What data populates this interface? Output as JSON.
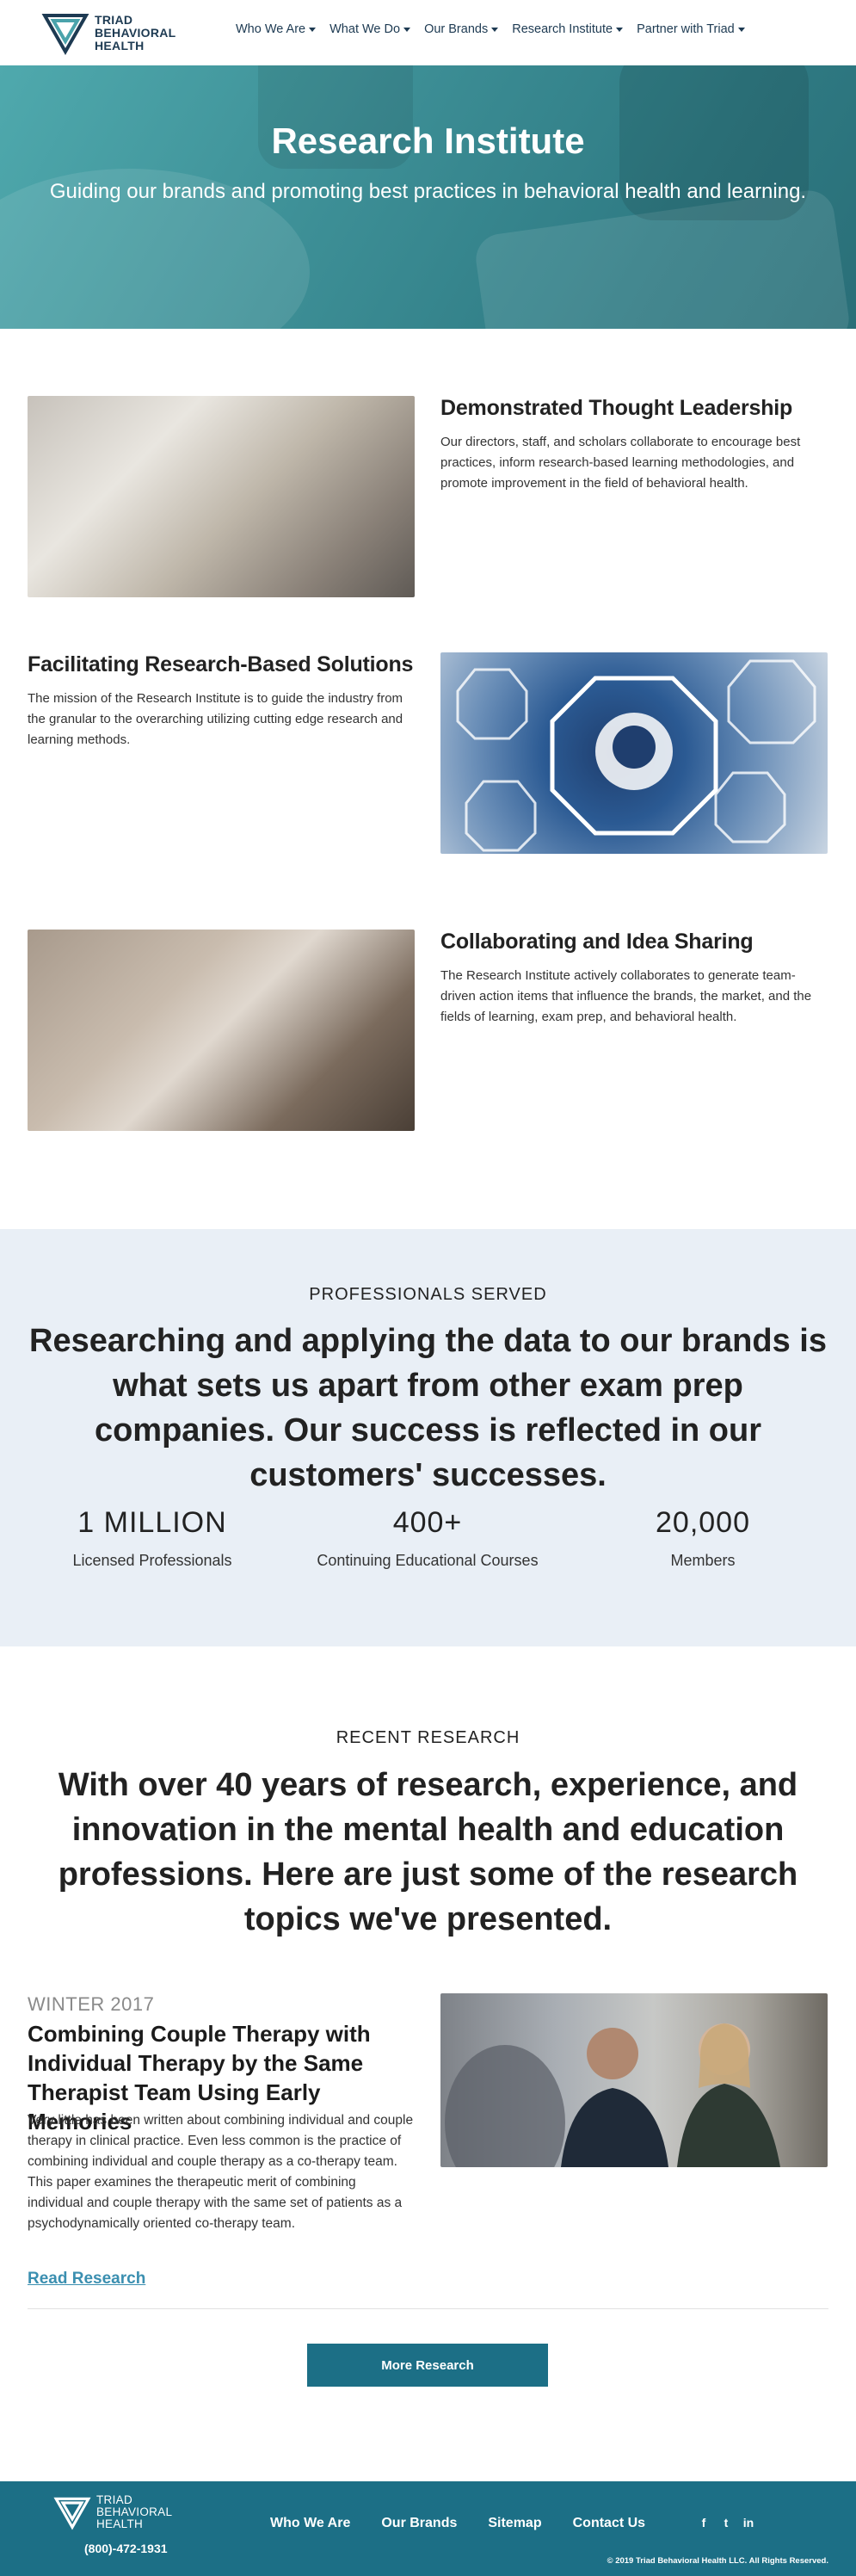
{
  "header": {
    "logo_lines": [
      "TRIAD",
      "BEHAVIORAL",
      "HEALTH"
    ],
    "nav": [
      {
        "label": "Who We Are"
      },
      {
        "label": "What We Do"
      },
      {
        "label": "Our Brands"
      },
      {
        "label": "Research Institute"
      },
      {
        "label": "Partner with Triad"
      }
    ]
  },
  "hero": {
    "title": "Research Institute",
    "subtitle": "Guiding our brands and promoting best practices in behavioral health and learning."
  },
  "features": [
    {
      "title": "Demonstrated Thought Leadership",
      "text": "Our directors, staff, and scholars collaborate to encourage best practices, inform research-based learning methodologies, and promote improvement in the field of behavioral health."
    },
    {
      "title": "Facilitating Research-Based Solutions",
      "text": "The mission of the Research Institute is to guide the industry from the granular to the overarching utilizing cutting edge research and learning methods."
    },
    {
      "title": "Collaborating and Idea Sharing",
      "text": "The Research Institute actively collaborates to generate team-driven action items that influence the brands, the market, and the fields of learning, exam prep, and behavioral health."
    }
  ],
  "professionals": {
    "eyebrow": "PROFESSIONALS SERVED",
    "headline": "Researching and applying the data to our brands is what sets us apart from other exam prep companies. Our success is reflected in our customers' successes.",
    "stats": [
      {
        "number": "1 MILLION",
        "label": "Licensed Professionals"
      },
      {
        "number": "400+",
        "label": "Continuing Educational Courses"
      },
      {
        "number": "20,000",
        "label": "Members"
      }
    ]
  },
  "recent": {
    "eyebrow": "RECENT RESEARCH",
    "headline": "With over 40 years of research, experience, and innovation in the mental health and education professions. Here are just some of the research topics we've presented.",
    "season": "WINTER 2017",
    "title": "Combining Couple Therapy with Individual Therapy by the Same Therapist Team Using Early Memories",
    "text": "Very little has been written about combining individual and couple therapy in clinical practice. Even less common is the practice of combining individual and couple therapy as a co-therapy team. This paper examines the therapeutic merit of combining individual and couple therapy with the same set of patients as a psychodynamically oriented co-therapy team.",
    "read_link": "Read Research",
    "more_button": "More Research"
  },
  "footer": {
    "logo_lines": [
      "TRIAD",
      "BEHAVIORAL",
      "HEALTH"
    ],
    "phone": "(800)-472-1931",
    "links": [
      "Who We Are",
      "Our Brands",
      "Sitemap",
      "Contact Us"
    ],
    "social": {
      "facebook": "f",
      "twitter": "t",
      "linkedin": "in"
    },
    "copyright": "© 2019 Triad Behavioral Health LLC. All Rights Reserved."
  },
  "colors": {
    "brand_dark": "#1d3a52",
    "brand_teal": "#1c6f86",
    "hero_teal": "#3d8f96",
    "section_bg": "#e9eff6",
    "link": "#3b8fb0"
  }
}
